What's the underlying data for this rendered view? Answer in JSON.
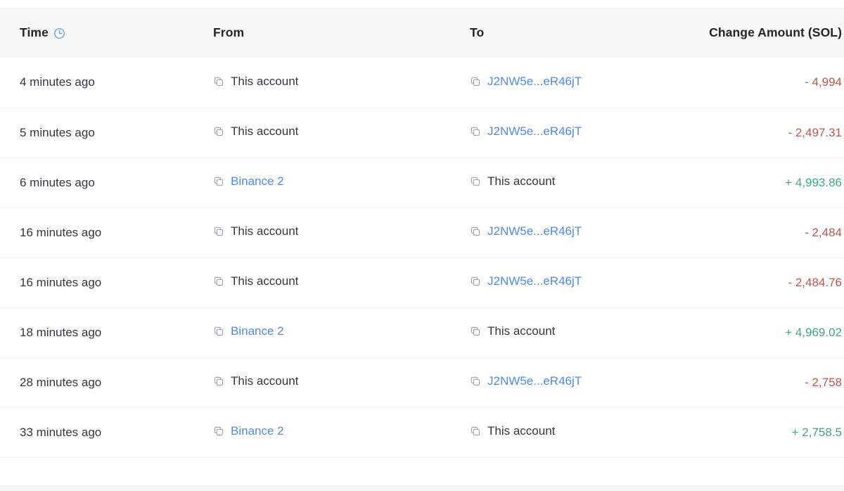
{
  "table": {
    "columns": [
      {
        "key": "time",
        "label": "Time",
        "icon": "clock-icon",
        "align": "left"
      },
      {
        "key": "from",
        "label": "From",
        "icon": null,
        "align": "left"
      },
      {
        "key": "to",
        "label": "To",
        "icon": null,
        "align": "left"
      },
      {
        "key": "amount",
        "label": "Change Amount (SOL)",
        "icon": null,
        "align": "right"
      }
    ],
    "row_icon": "copy-icon",
    "rows": [
      {
        "time": "4 minutes ago",
        "from": "This account",
        "from_link": false,
        "to": "J2NW5e...eR46jT",
        "to_link": true,
        "amount": "- 4,994",
        "amount_sign": "negative"
      },
      {
        "time": "5 minutes ago",
        "from": "This account",
        "from_link": false,
        "to": "J2NW5e...eR46jT",
        "to_link": true,
        "amount": "- 2,497.31",
        "amount_sign": "negative"
      },
      {
        "time": "6 minutes ago",
        "from": "Binance 2",
        "from_link": true,
        "to": "This account",
        "to_link": false,
        "amount": "+ 4,993.86",
        "amount_sign": "positive"
      },
      {
        "time": "16 minutes ago",
        "from": "This account",
        "from_link": false,
        "to": "J2NW5e...eR46jT",
        "to_link": true,
        "amount": "- 2,484",
        "amount_sign": "negative"
      },
      {
        "time": "16 minutes ago",
        "from": "This account",
        "from_link": false,
        "to": "J2NW5e...eR46jT",
        "to_link": true,
        "amount": "- 2,484.76",
        "amount_sign": "negative"
      },
      {
        "time": "18 minutes ago",
        "from": "Binance 2",
        "from_link": true,
        "to": "This account",
        "to_link": false,
        "amount": "+ 4,969.02",
        "amount_sign": "positive"
      },
      {
        "time": "28 minutes ago",
        "from": "This account",
        "from_link": false,
        "to": "J2NW5e...eR46jT",
        "to_link": true,
        "amount": "- 2,758",
        "amount_sign": "negative"
      },
      {
        "time": "33 minutes ago",
        "from": "Binance 2",
        "from_link": true,
        "to": "This account",
        "to_link": false,
        "amount": "+ 2,758.5",
        "amount_sign": "positive"
      }
    ]
  },
  "colors": {
    "link": "#4f8ae8",
    "positive": "#3fa884",
    "negative": "#c0564f",
    "header_background": "#f6f6f7",
    "header_text": "#22262b",
    "body_text": "#33373d",
    "row_divider": "#f1f2f4",
    "icon_gray": "#9aa0a6",
    "clock_blue": "#5b9bd5"
  }
}
